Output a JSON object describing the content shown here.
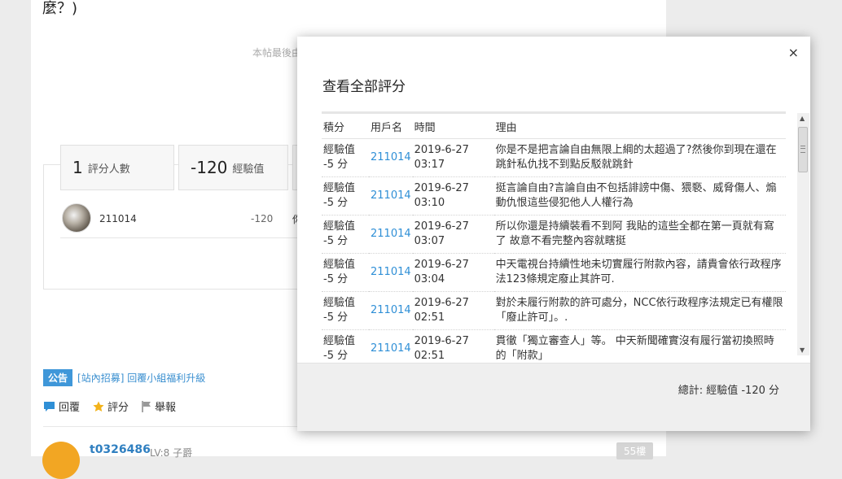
{
  "background": {
    "post_tail": "麼？)",
    "last_edit": "本帖最後由",
    "stats": [
      {
        "num": "1",
        "unit": "評分人數"
      },
      {
        "num": "-120",
        "unit": "經驗值"
      }
    ],
    "rater": {
      "name": "211014",
      "value": "-120",
      "cut": "你"
    },
    "notice": {
      "tag": "公告",
      "link": "[站內招募] 回覆小組福利升級"
    },
    "actions": {
      "reply": "回覆",
      "rate": "評分",
      "report": "舉報"
    },
    "next_post": {
      "user": "t0326486",
      "level": "LV:8 子爵",
      "floor": "55樓"
    }
  },
  "modal": {
    "close": "×",
    "title": "查看全部評分",
    "headers": {
      "score": "積分",
      "user": "用戶名",
      "time": "時間",
      "reason": "理由"
    },
    "rows": [
      {
        "score": "經驗值 -5 分",
        "user": "211014",
        "time": "2019-6-27 03:17",
        "reason": "你是不是把言論自由無限上綱的太超過了?然後你到現在還在跳針私仇找不到點反駁就跳針"
      },
      {
        "score": "經驗值 -5 分",
        "user": "211014",
        "time": "2019-6-27 03:10",
        "reason": "挺言論自由?言論自由不包括誹謗中傷、猥褻、威脅傷人、煽動仇恨這些侵犯他人人權行為"
      },
      {
        "score": "經驗值 -5 分",
        "user": "211014",
        "time": "2019-6-27 03:07",
        "reason": "所以你還是持續裝看不到阿 我貼的這些全都在第一頁就有寫了 故意不看完整內容就瞎挺"
      },
      {
        "score": "經驗值 -5 分",
        "user": "211014",
        "time": "2019-6-27 03:04",
        "reason": "中天電視台持續性地未切實履行附款內容，請貴會依行政程序法123條規定廢止其許可."
      },
      {
        "score": "經驗值 -5 分",
        "user": "211014",
        "time": "2019-6-27 02:51",
        "reason": "對於未履行附款的許可處分，NCC依行政程序法規定已有權限「廢止許可」。."
      },
      {
        "score": "經驗值 -5 分",
        "user": "211014",
        "time": "2019-6-27 02:51",
        "reason": "貫徹「獨立審查人」等。 中天新聞確實沒有履行當初換照時的「附款」"
      }
    ],
    "total": "總計: 經驗值 -120 分"
  }
}
